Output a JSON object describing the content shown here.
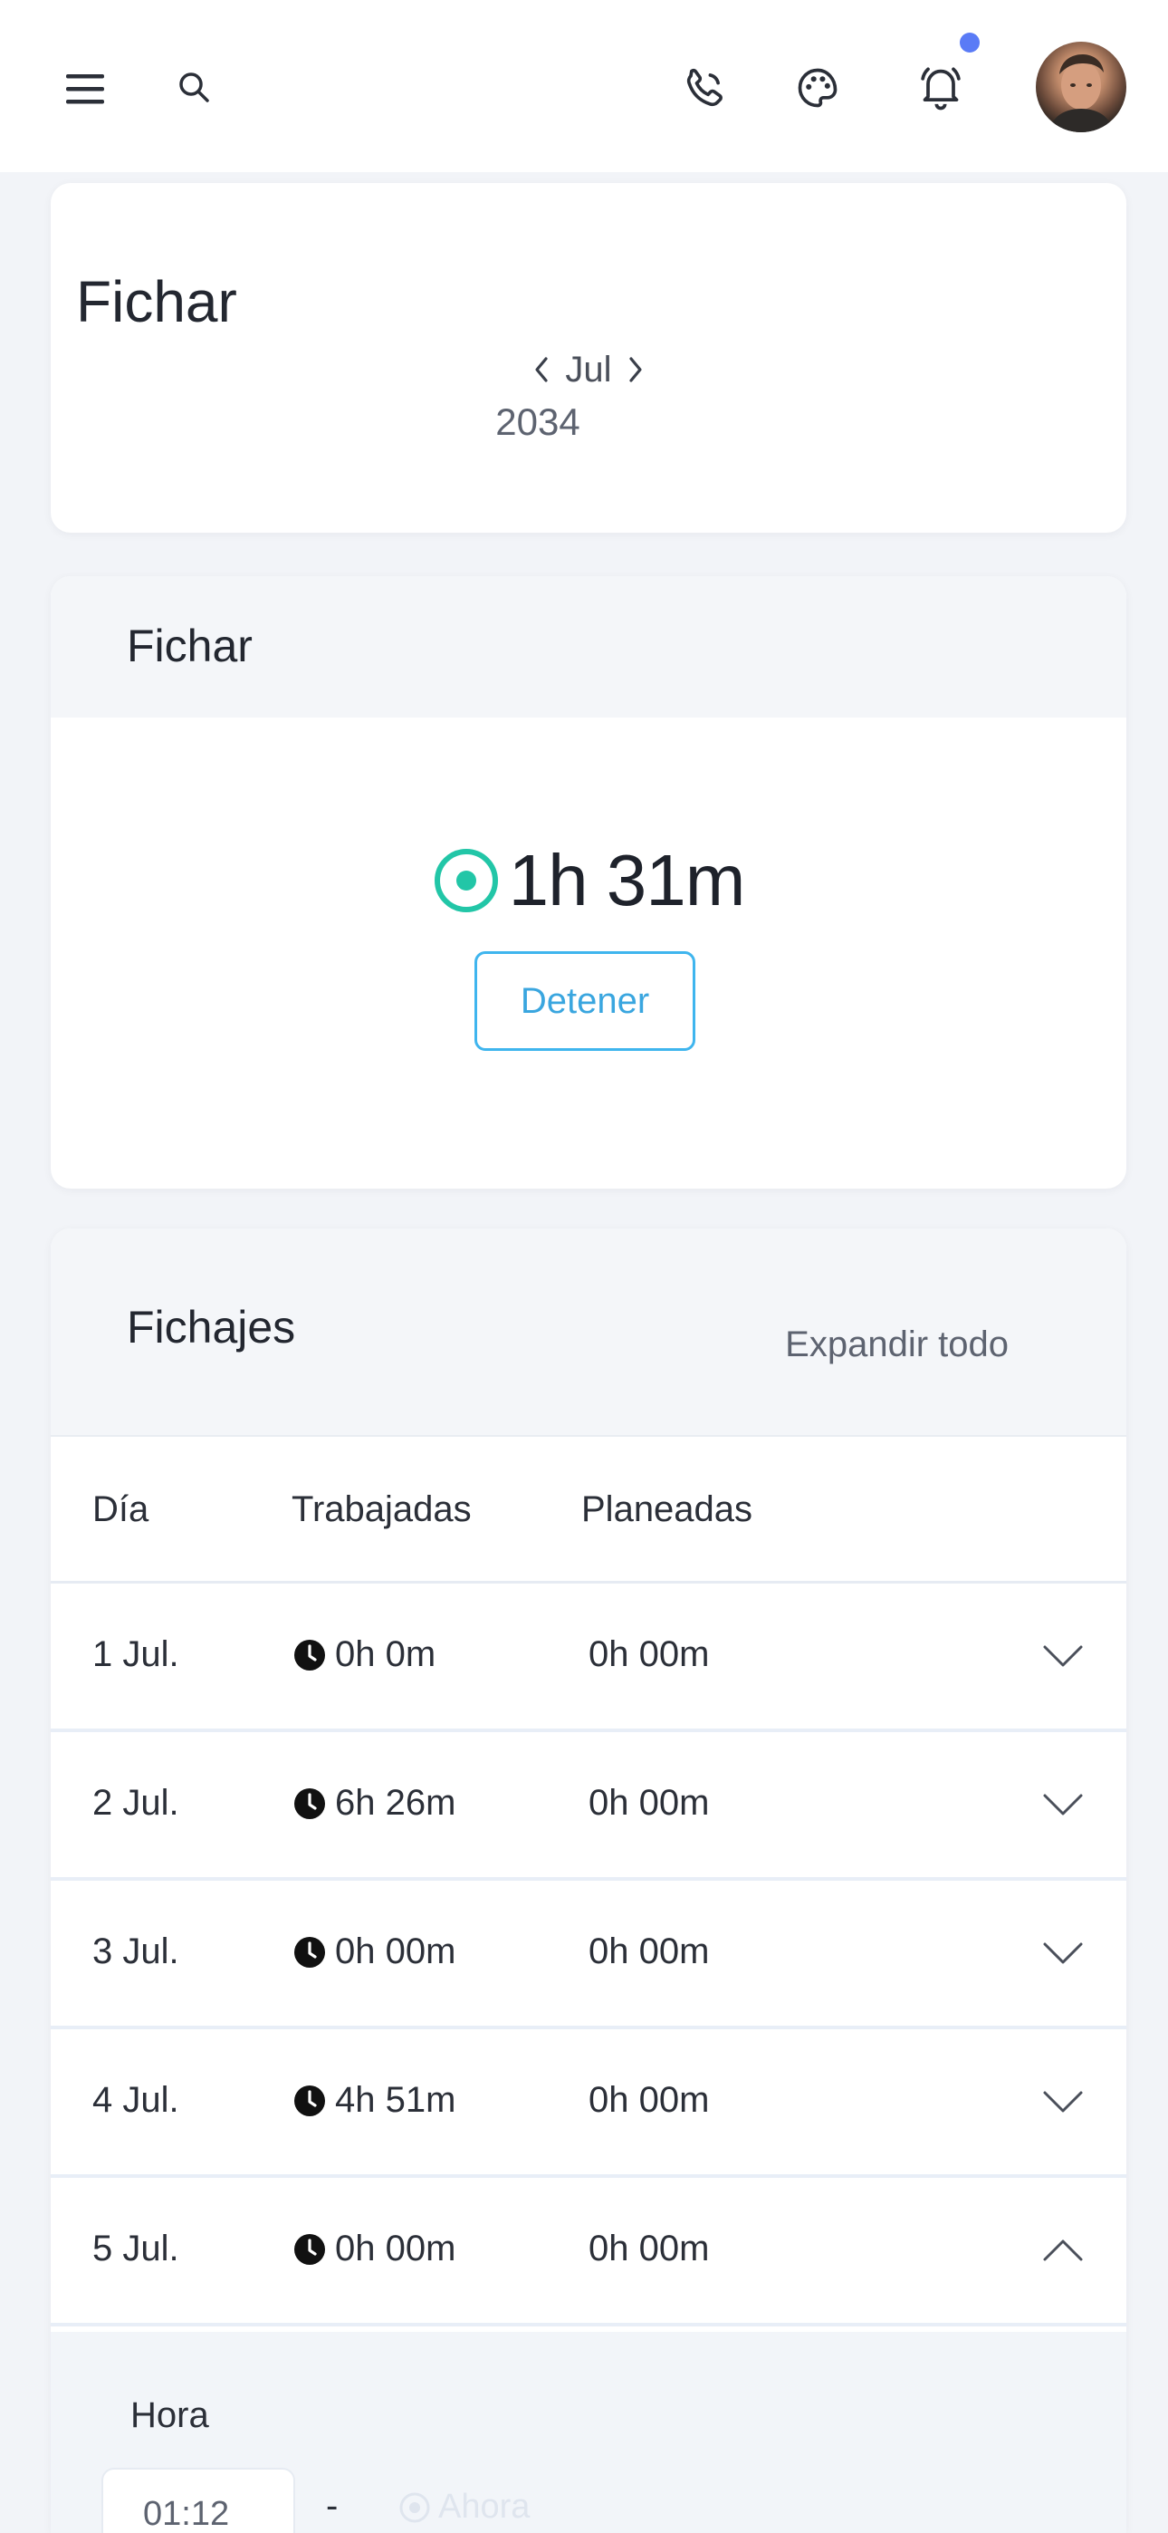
{
  "colors": {
    "accent_teal": "#22c6a7",
    "accent_blue": "#3aa6df",
    "notification_dot": "#5a7bf6",
    "header_bg": "#f4f6f9"
  },
  "topbar": {
    "icons": [
      "menu-icon",
      "search-icon",
      "phone-icon",
      "palette-icon",
      "bell-icon"
    ],
    "has_notification": true
  },
  "period": {
    "title": "Fichar",
    "month": "Jul",
    "year": "2034"
  },
  "clock": {
    "title": "Fichar",
    "elapsed": "1h 31m",
    "stop_label": "Detener"
  },
  "log": {
    "title": "Fichajes",
    "expand_all_label": "Expandir todo",
    "columns": [
      "Día",
      "Trabajadas",
      "Planeadas"
    ],
    "rows": [
      {
        "day": "1 Jul.",
        "worked": "0h 0m",
        "planned": "0h 00m",
        "expanded": false
      },
      {
        "day": "2 Jul.",
        "worked": "6h 26m",
        "planned": "0h 00m",
        "expanded": false
      },
      {
        "day": "3 Jul.",
        "worked": "0h 00m",
        "planned": "0h 00m",
        "expanded": false
      },
      {
        "day": "4 Jul.",
        "worked": "4h 51m",
        "planned": "0h 00m",
        "expanded": false
      },
      {
        "day": "5 Jul.",
        "worked": "0h 00m",
        "planned": "0h 00m",
        "expanded": true
      }
    ],
    "detail": {
      "hour_label": "Hora",
      "start_time": "01:12",
      "separator": "-",
      "now_label": "Ahora"
    }
  }
}
